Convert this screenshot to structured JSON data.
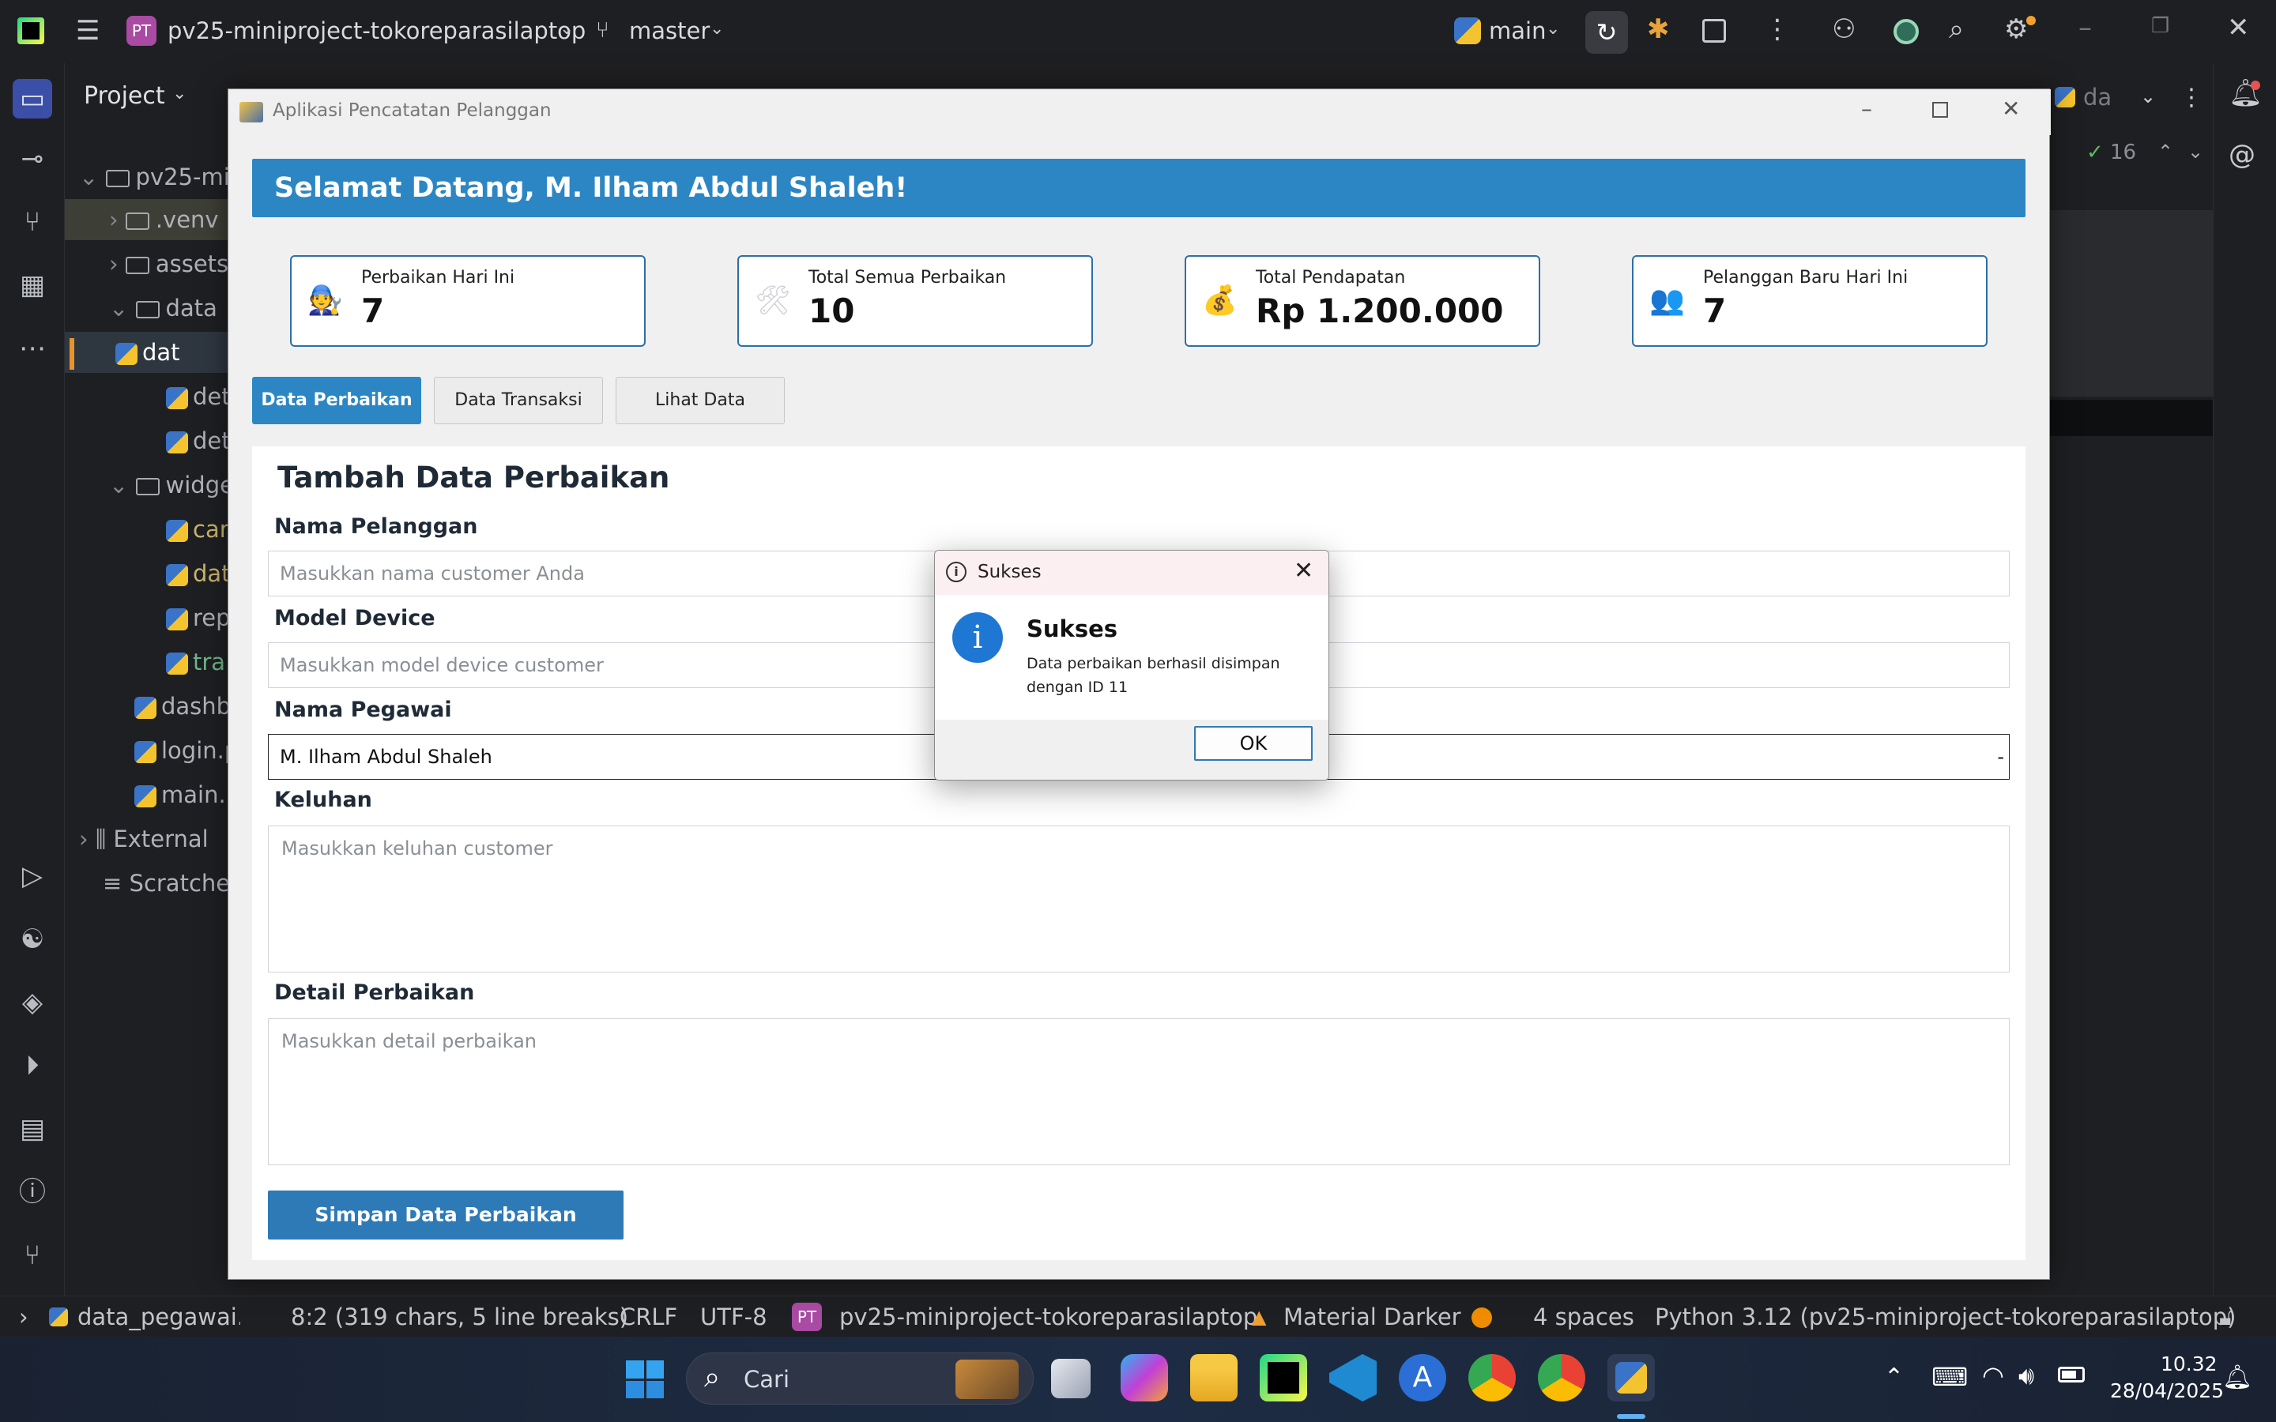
{
  "ide": {
    "project_badge": "PT",
    "project_name": "pv25-miniproject-tokoreparasilaptop",
    "branch": "master",
    "run_config": "main",
    "tool_window_title": "Project",
    "right_tab_label": "da",
    "inspection_count": "16"
  },
  "tree": {
    "items": [
      {
        "label": "pv25-mi",
        "type": "root"
      },
      {
        "label": ".venv",
        "type": "folder"
      },
      {
        "label": "assets",
        "type": "folder"
      },
      {
        "label": "data",
        "type": "folder"
      },
      {
        "label": "dat",
        "type": "py"
      },
      {
        "label": "det",
        "type": "py"
      },
      {
        "label": "det",
        "type": "py"
      },
      {
        "label": "widge",
        "type": "folder"
      },
      {
        "label": "car",
        "type": "py"
      },
      {
        "label": "dat",
        "type": "py"
      },
      {
        "label": "rep",
        "type": "py"
      },
      {
        "label": "tra",
        "type": "py"
      },
      {
        "label": "dashb",
        "type": "py"
      },
      {
        "label": "login.p",
        "type": "py"
      },
      {
        "label": "main.p",
        "type": "py"
      },
      {
        "label": "External",
        "type": "lib"
      },
      {
        "label": "Scratche",
        "type": "scratch"
      }
    ]
  },
  "status": {
    "file": "data_pegawai.p",
    "position": "8:2 (319 chars, 5 line breaks)",
    "line_sep": "CRLF",
    "encoding": "UTF-8",
    "project_badge": "PT",
    "project": "pv25-miniproject-tokoreparasilaptop",
    "theme": "Material Darker",
    "indent": "4 spaces",
    "interpreter": "Python 3.12 (pv25-miniproject-tokoreparasilaptop)"
  },
  "taskbar": {
    "search_placeholder": "Cari",
    "time": "10.32",
    "date": "28/04/2025"
  },
  "app": {
    "window_title": "Aplikasi Pencatatan Pelanggan",
    "welcome": "Selamat Datang, M. Ilham Abdul Shaleh!",
    "cards": [
      {
        "label": "Perbaikan Hari Ini",
        "value": "7",
        "icon": "technician-icon"
      },
      {
        "label": "Total Semua Perbaikan",
        "value": "10",
        "icon": "tools-icon"
      },
      {
        "label": "Total Pendapatan",
        "value": "Rp 1.200.000",
        "icon": "money-icon"
      },
      {
        "label": "Pelanggan Baru Hari Ini",
        "value": "7",
        "icon": "customers-icon"
      }
    ],
    "tabs": [
      {
        "label": "Data Perbaikan",
        "active": true
      },
      {
        "label": "Data Transaksi",
        "active": false
      },
      {
        "label": "Lihat Data",
        "active": false
      }
    ],
    "form": {
      "heading": "Tambah Data Perbaikan",
      "customer_label": "Nama Pelanggan",
      "customer_placeholder": "Masukkan nama customer Anda",
      "device_label": "Model Device",
      "device_placeholder": "Masukkan model device customer",
      "employee_label": "Nama Pegawai",
      "employee_value": "M. Ilham Abdul Shaleh",
      "complaint_label": "Keluhan",
      "complaint_placeholder": "Masukkan keluhan customer",
      "detail_label": "Detail Perbaikan",
      "detail_placeholder": "Masukkan detail perbaikan",
      "save_button": "Simpan Data Perbaikan"
    }
  },
  "dialog": {
    "title": "Sukses",
    "heading": "Sukses",
    "message_line1": "Data perbaikan berhasil disimpan",
    "message_line2": "dengan ID 11",
    "ok": "OK"
  },
  "colors": {
    "accent": "#2d86c4",
    "ide_bg": "#1e1f22",
    "dialog_info": "#1e78d3"
  }
}
